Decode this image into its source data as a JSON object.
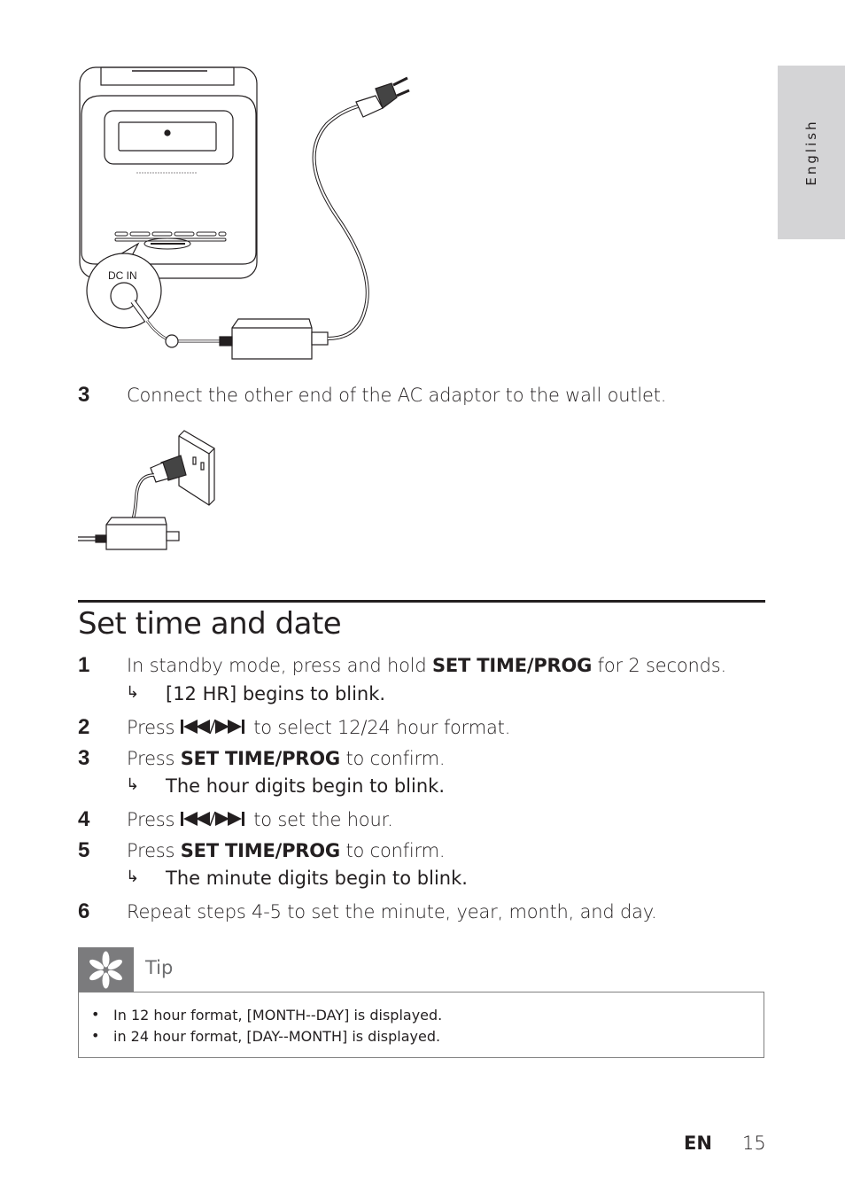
{
  "side_tab": {
    "language": "English"
  },
  "figure_top": {
    "callout_label": "DC IN",
    "description": "Unit rear with AC adaptor connected to DC IN"
  },
  "step_before": {
    "number": "3",
    "text": "Connect the other end of the AC adaptor to the wall outlet."
  },
  "figure_outlet": {
    "description": "AC adaptor plugged into wall outlet"
  },
  "section": {
    "title": "Set time and date",
    "steps": [
      {
        "number": "1",
        "pre": "In standby mode, press and hold ",
        "bold": "SET TIME/PROG",
        "post": " for 2 seconds.",
        "result": "[12 HR] begins to blink."
      },
      {
        "number": "2",
        "pre": "Press ",
        "icon": "skip-prev-next-icon",
        "post": " to select 12/24 hour format."
      },
      {
        "number": "3",
        "pre": "Press ",
        "bold": "SET TIME/PROG",
        "post": " to confirm.",
        "result": "The hour digits begin to blink."
      },
      {
        "number": "4",
        "pre": "Press ",
        "icon": "skip-prev-next-icon",
        "post": " to set the hour."
      },
      {
        "number": "5",
        "pre": "Press ",
        "bold": "SET TIME/PROG",
        "post": " to confirm.",
        "result": "The minute digits begin to blink."
      },
      {
        "number": "6",
        "text": "Repeat steps 4-5 to set the minute, year, month, and day."
      }
    ],
    "result_arrow": "↳"
  },
  "tip": {
    "label": "Tip",
    "icon": "asterisk-icon",
    "items": [
      "In 12 hour format, [MONTH--DAY] is displayed.",
      "in 24 hour format, [DAY--MONTH] is displayed."
    ],
    "bullet": "•"
  },
  "footer": {
    "language_code": "EN",
    "page_number": "15"
  }
}
